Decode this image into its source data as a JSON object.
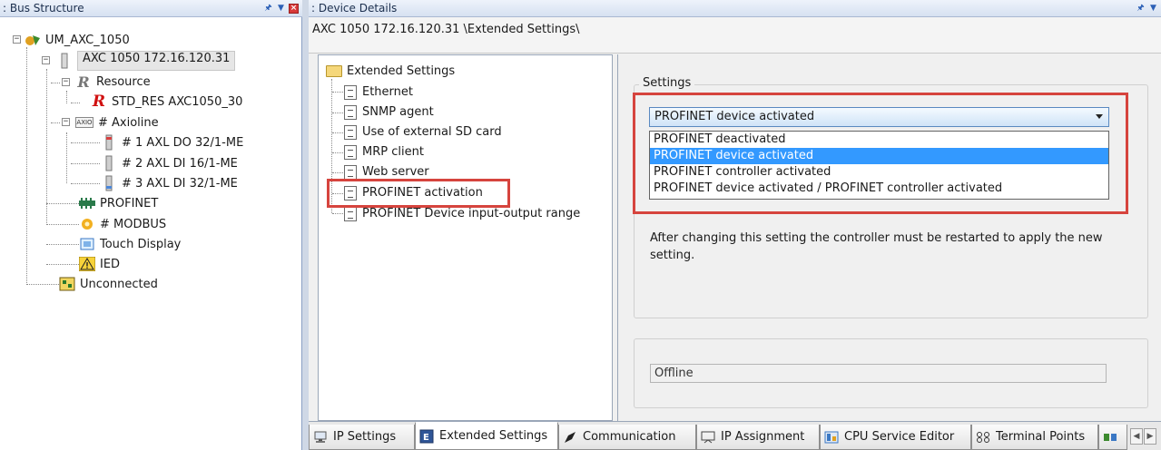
{
  "bus_panel": {
    "title": ": Bus Structure",
    "tree": {
      "root": "UM_AXC_1050",
      "controller": "AXC 1050 172.16.120.31",
      "resource": "Resource",
      "std_res": "STD_RES AXC1050_30",
      "axioline": "# Axioline",
      "axioline_badge": "AXIO",
      "modules": [
        "# 1 AXL DO 32/1-ME",
        "# 2 AXL DI 16/1-ME",
        "# 3 AXL DI 32/1-ME"
      ],
      "profinet": "PROFINET",
      "modbus": "# MODBUS",
      "touch_display": "Touch Display",
      "ied": "IED",
      "unconnected": "Unconnected"
    }
  },
  "detail_panel": {
    "title": ": Device Details",
    "path": "AXC 1050 172.16.120.31 \\Extended Settings\\",
    "settings_tree": {
      "folder": "Extended Settings",
      "items": [
        "Ethernet",
        "SNMP agent",
        "Use of external SD card",
        "MRP client",
        "Web server",
        "PROFINET activation",
        "PROFINET Device input-output range"
      ]
    },
    "settings": {
      "group_title": "Settings",
      "selected_value": "PROFINET device activated",
      "options": [
        "PROFINET deactivated",
        "PROFINET device activated",
        "PROFINET controller activated",
        "PROFINET device activated / PROFINET controller activated"
      ],
      "highlighted_option_index": 1,
      "note": "After changing this setting the controller must be restarted to apply the new setting.",
      "status": "Offline"
    },
    "tabs": [
      "IP Settings",
      "Extended Settings",
      "Communication",
      "IP Assignment",
      "CPU Service Editor",
      "Terminal Points"
    ],
    "active_tab": "Extended Settings"
  },
  "colors": {
    "highlight_red": "#d6443e",
    "selection_blue": "#3399ff",
    "resource_red": "#d01010"
  }
}
